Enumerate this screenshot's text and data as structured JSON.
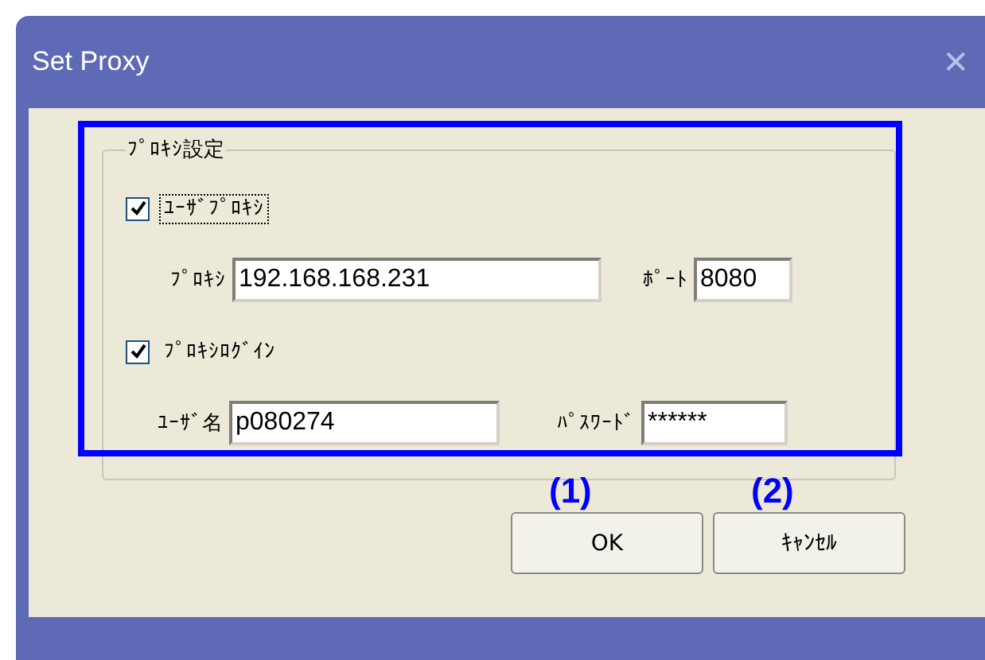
{
  "window": {
    "title": "Set Proxy",
    "close": "✕"
  },
  "group": {
    "title": "ﾌﾟﾛｷｼ設定",
    "use_proxy": {
      "label": "ﾕｰｻﾞﾌﾟﾛｷｼ",
      "checked": true,
      "focused": true
    },
    "proxy": {
      "label": "ﾌﾟﾛｷｼ",
      "value": "192.168.168.231"
    },
    "port": {
      "label": "ﾎﾟｰﾄ",
      "value": "8080"
    },
    "proxy_login": {
      "label": "ﾌﾟﾛｷｼﾛｸﾞｲﾝ",
      "checked": true
    },
    "user": {
      "label": "ﾕｰｻﾞ名",
      "value": "p080274"
    },
    "password": {
      "label": "ﾊﾟｽﾜｰﾄﾞ",
      "value": "******"
    }
  },
  "annotations": [
    "(1)",
    "(2)"
  ],
  "buttons": [
    "OK",
    "ｷｬﾝｾﾙ"
  ]
}
